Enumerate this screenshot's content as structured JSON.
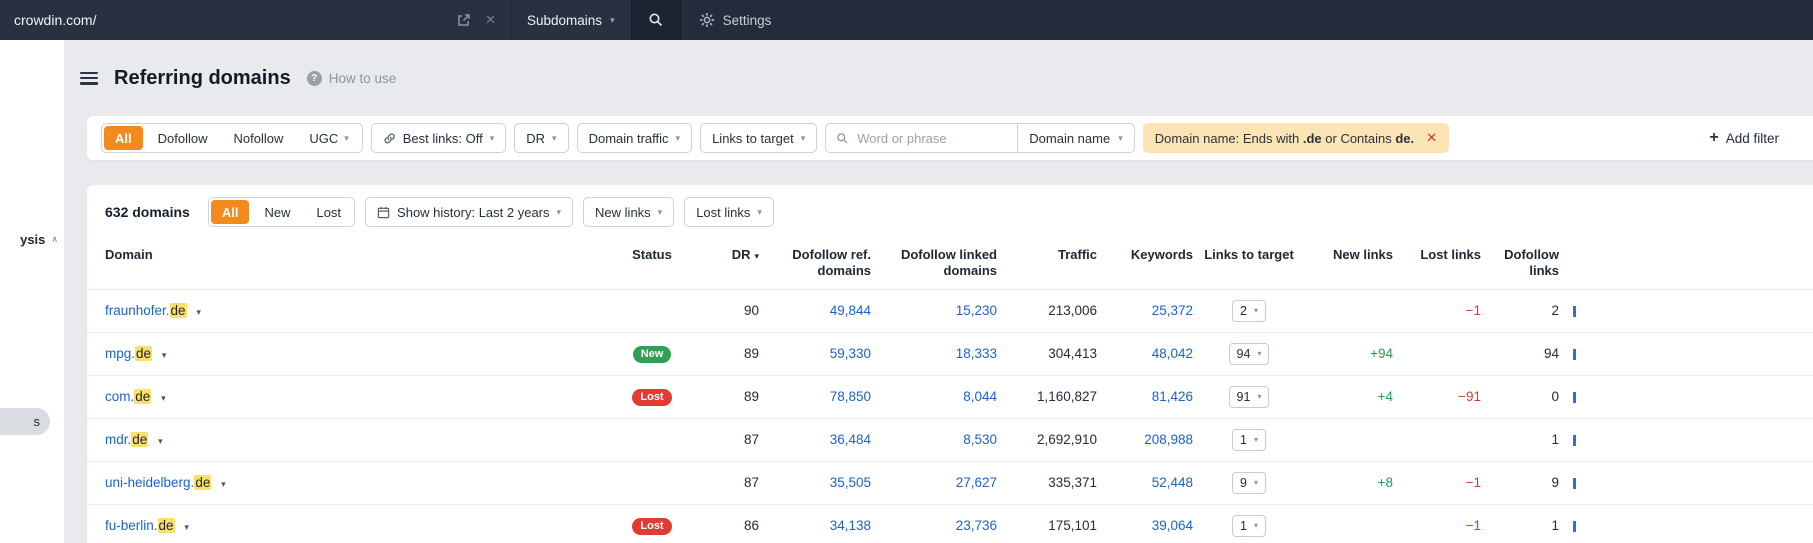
{
  "navbar": {
    "url_value": "crowdin.com/",
    "scope_select": "Subdomains",
    "settings_label": "Settings"
  },
  "sidebar": {
    "section_label_partial": "ysis",
    "item_label_partial": "s"
  },
  "header": {
    "title": "Referring domains",
    "help_label": "How to use"
  },
  "filter_bar": {
    "segments": [
      "All",
      "Dofollow",
      "Nofollow",
      "UGC"
    ],
    "active_segment": "All",
    "best_links_label": "Best links: Off",
    "dr_label": "DR",
    "domain_traffic_label": "Domain traffic",
    "links_to_target_label": "Links to target",
    "search_placeholder": "Word or phrase",
    "domain_name_label": "Domain name",
    "active_filter": {
      "text_1": "Domain name: Ends with ",
      "bold_1": ".de",
      "text_2": " or Contains ",
      "bold_2": "de."
    },
    "add_filter_label": "Add filter"
  },
  "toolbar": {
    "count_label": "632 domains",
    "segments": [
      "All",
      "New",
      "Lost"
    ],
    "active_segment": "All",
    "show_history_label": "Show history: Last 2 years",
    "new_links_label": "New links",
    "lost_links_label": "Lost links"
  },
  "table": {
    "columns": [
      "Domain",
      "Status",
      "DR",
      "Dofollow ref.\ndomains",
      "Dofollow linked\ndomains",
      "Traffic",
      "Keywords",
      "Links to target",
      "New links",
      "Lost links",
      "Dofollow\nlinks"
    ],
    "sorted_column": "DR",
    "rows": [
      {
        "domain_base": "fraunhofer.",
        "domain_match": "de",
        "status": "",
        "dr": "90",
        "dofollow_ref_domains": "49,844",
        "dofollow_linked_domains": "15,230",
        "traffic": "213,006",
        "keywords": "25,372",
        "links_to_target": "2",
        "new_links": "",
        "lost_links": "−1",
        "dofollow_links": "2"
      },
      {
        "domain_base": "mpg.",
        "domain_match": "de",
        "status": "New",
        "dr": "89",
        "dofollow_ref_domains": "59,330",
        "dofollow_linked_domains": "18,333",
        "traffic": "304,413",
        "keywords": "48,042",
        "links_to_target": "94",
        "new_links": "+94",
        "lost_links": "",
        "dofollow_links": "94"
      },
      {
        "domain_base": "com.",
        "domain_match": "de",
        "status": "Lost",
        "dr": "89",
        "dofollow_ref_domains": "78,850",
        "dofollow_linked_domains": "8,044",
        "traffic": "1,160,827",
        "keywords": "81,426",
        "links_to_target": "91",
        "new_links": "+4",
        "lost_links": "−91",
        "dofollow_links": "0"
      },
      {
        "domain_base": "mdr.",
        "domain_match": "de",
        "status": "",
        "dr": "87",
        "dofollow_ref_domains": "36,484",
        "dofollow_linked_domains": "8,530",
        "traffic": "2,692,910",
        "keywords": "208,988",
        "links_to_target": "1",
        "new_links": "",
        "lost_links": "",
        "dofollow_links": "1"
      },
      {
        "domain_base": "uni-heidelberg.",
        "domain_match": "de",
        "status": "",
        "dr": "87",
        "dofollow_ref_domains": "35,505",
        "dofollow_linked_domains": "27,627",
        "traffic": "335,371",
        "keywords": "52,448",
        "links_to_target": "9",
        "new_links": "+8",
        "lost_links": "−1",
        "dofollow_links": "9"
      },
      {
        "domain_base": "fu-berlin.",
        "domain_match": "de",
        "status": "Lost",
        "dr": "86",
        "dofollow_ref_domains": "34,138",
        "dofollow_linked_domains": "23,736",
        "traffic": "175,101",
        "keywords": "39,064",
        "links_to_target": "1",
        "new_links": "",
        "lost_links": "−1",
        "dofollow_links": "1"
      }
    ]
  },
  "icons": {
    "chevron_down": "▾",
    "collapse": "∧",
    "close": "✕",
    "question": "?",
    "sort_desc": "▾"
  },
  "colors": {
    "accent_orange": "#f28a1e",
    "link_blue": "#1a63c9",
    "positive_green": "#1f9e54",
    "negative_red": "#d03a30",
    "badge_new": "#2fa156",
    "badge_lost": "#e13c33",
    "highlight_yellow": "#fbdf6b",
    "navbar_bg": "#222c3a",
    "chip_bg": "#fbe5b4"
  }
}
